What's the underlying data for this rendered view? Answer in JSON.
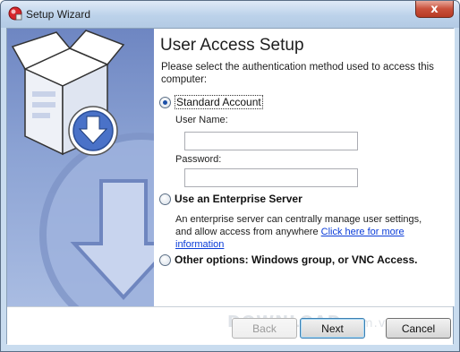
{
  "window": {
    "title": "Setup Wizard",
    "close_label": "x"
  },
  "page": {
    "heading": "User Access Setup",
    "description": "Please select the authentication method used to access this computer:"
  },
  "options": {
    "standard": {
      "label": "Standard Account",
      "selected": true
    },
    "username_label": "User Name:",
    "username_value": "",
    "password_label": "Password:",
    "password_value": "",
    "enterprise": {
      "label": "Use an Enterprise Server",
      "selected": false
    },
    "enterprise_note_line1": "An enterprise server can centrally manage user settings,",
    "enterprise_note_line2": "and allow access from anywhere",
    "enterprise_link": "Click here for more information",
    "other": {
      "label": "Other options: Windows group, or VNC Access.",
      "selected": false
    }
  },
  "footer": {
    "back_label": "Back",
    "next_label": "Next",
    "cancel_label": "Cancel",
    "watermark_main": "DOWNLOAD",
    "watermark_suffix": ".com.vn"
  },
  "colors": {
    "side_panel": "#8ca3d4",
    "link": "#0a3cd8",
    "close_button": "#c9503a",
    "selected_radio": "#1b4fa8"
  },
  "icons": [
    "setup-wizard-app-icon",
    "software-box-icon",
    "download-arrow-icon"
  ]
}
